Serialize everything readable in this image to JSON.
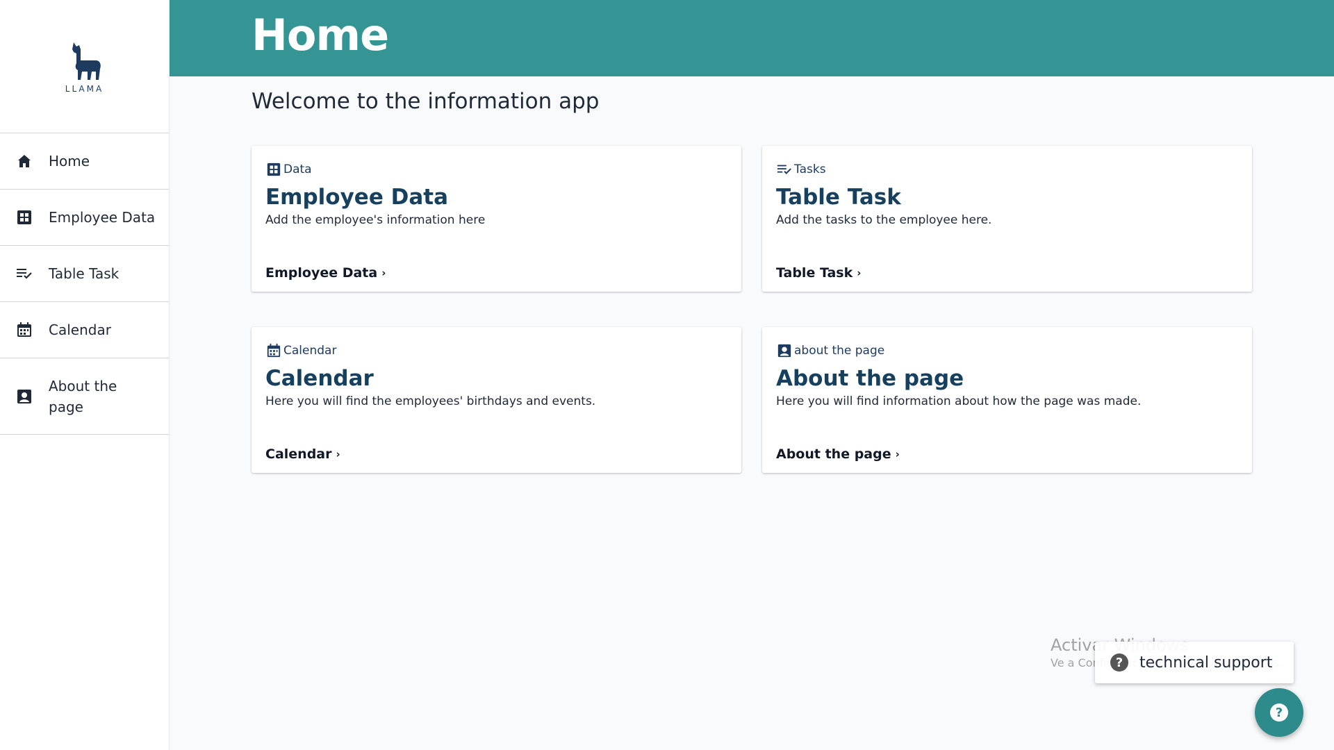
{
  "sidebar": {
    "logo_text": "LLAMA",
    "items": [
      {
        "label": "Home",
        "icon": "home-icon"
      },
      {
        "label": "Employee Data",
        "icon": "grid-icon"
      },
      {
        "label": "Table Task",
        "icon": "checklist-icon"
      },
      {
        "label": "Calendar",
        "icon": "calendar-icon"
      },
      {
        "label": "About the page",
        "icon": "contact-card-icon"
      }
    ]
  },
  "header": {
    "title": "Home",
    "color": "#359494"
  },
  "main": {
    "welcome": "Welcome to the information app",
    "cards": [
      {
        "category": "Data",
        "title": "Employee Data",
        "description": "Add the employee's information here",
        "link": "Employee Data"
      },
      {
        "category": "Tasks",
        "title": "Table Task",
        "description": "Add the tasks to the employee here.",
        "link": "Table Task"
      },
      {
        "category": "Calendar",
        "title": "Calendar",
        "description": "Here you will find the employees' birthdays and events.",
        "link": "Calendar"
      },
      {
        "category": "about the page",
        "title": "About the page",
        "description": "Here you will find information about how the page was made.",
        "link": "About the page"
      }
    ]
  },
  "watermark": {
    "title": "Activar Windows",
    "subtitle": "Ve a Configuración para activar Windows."
  },
  "support": {
    "label": "technical support"
  },
  "colors": {
    "accent": "#359494",
    "title": "#17405f"
  }
}
